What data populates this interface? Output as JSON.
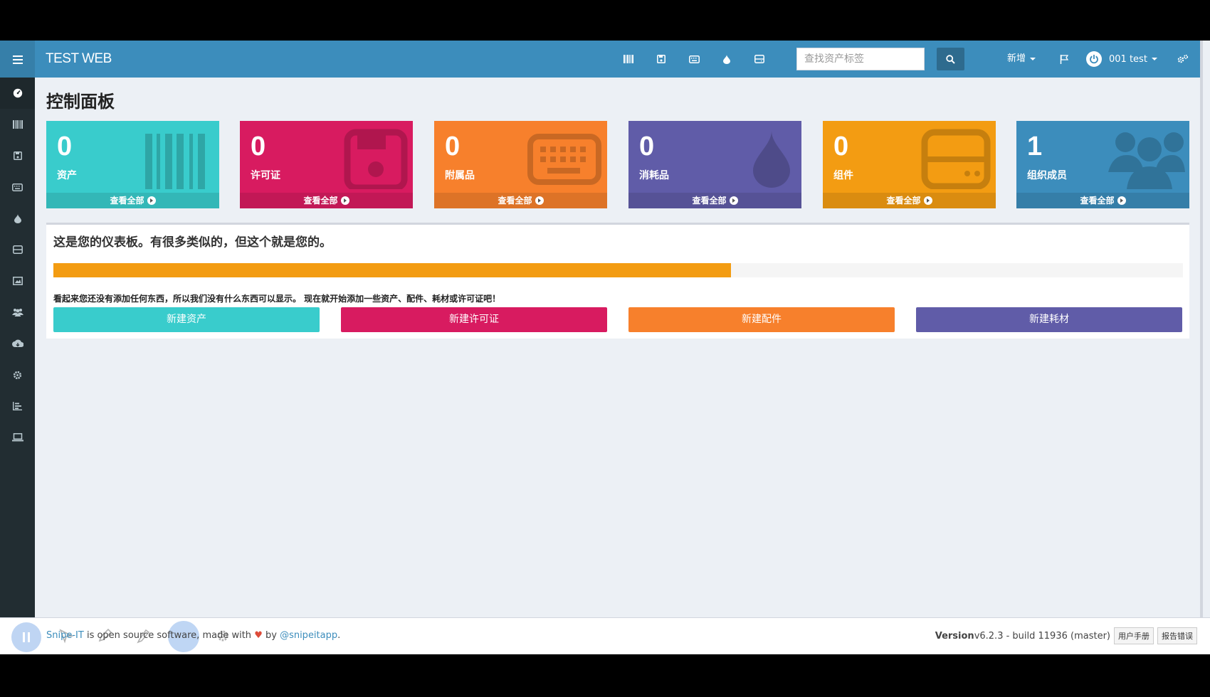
{
  "header": {
    "brand": "TEST WEB",
    "search_placeholder": "查找资产标签",
    "new_label": "新增",
    "user_label": "001 test"
  },
  "page": {
    "title": "控制面板"
  },
  "cards": [
    {
      "count": "0",
      "label": "资产",
      "footer": "查看全部",
      "color": "#39cccc",
      "icon": "barcode-icon"
    },
    {
      "count": "0",
      "label": "许可证",
      "footer": "查看全部",
      "color": "#d81b60",
      "icon": "floppy-disk-icon"
    },
    {
      "count": "0",
      "label": "附属品",
      "footer": "查看全部",
      "color": "#f7802c",
      "icon": "keyboard-icon"
    },
    {
      "count": "0",
      "label": "消耗品",
      "footer": "查看全部",
      "color": "#605ca8",
      "icon": "tint-drop-icon"
    },
    {
      "count": "0",
      "label": "组件",
      "footer": "查看全部",
      "color": "#f39c12",
      "icon": "hdd-icon"
    },
    {
      "count": "1",
      "label": "组织成员",
      "footer": "查看全部",
      "color": "#3c8dbc",
      "icon": "users-icon"
    }
  ],
  "panel": {
    "welcome": "这是您的仪表板。有很多类似的，但这个就是您的。",
    "progress": 0.6,
    "progress_color": "#f39c12",
    "empty_message": "看起来您还没有添加任何东西，所以我们没有什么东西可以显示。 现在就开始添加一些资产、配件、耗材或许可证吧！",
    "buttons": [
      {
        "label": "新建资产",
        "color": "#39cccc"
      },
      {
        "label": "新建许可证",
        "color": "#d81b60"
      },
      {
        "label": "新建配件",
        "color": "#f7802c"
      },
      {
        "label": "新建耗材",
        "color": "#605ca8"
      }
    ]
  },
  "footer": {
    "brand_link": "Snipe-IT",
    "text_mid": " is open source software, made with ",
    "text_by": " by ",
    "author_link": "@snipeitapp",
    "period": ".",
    "version_label": "Version",
    "version_value": " v6.2.3 - build 11936 (master)",
    "manual_button": "用户手册",
    "report_button": "报告错误"
  },
  "sidebar": {
    "items": [
      "dashboard-icon",
      "barcode-icon",
      "floppy-disk-icon",
      "keyboard-icon",
      "tint-drop-icon",
      "hdd-icon",
      "picture-icon",
      "users-icon",
      "cloud-download-icon",
      "cog-icon",
      "bar-chart-icon",
      "laptop-icon"
    ]
  }
}
